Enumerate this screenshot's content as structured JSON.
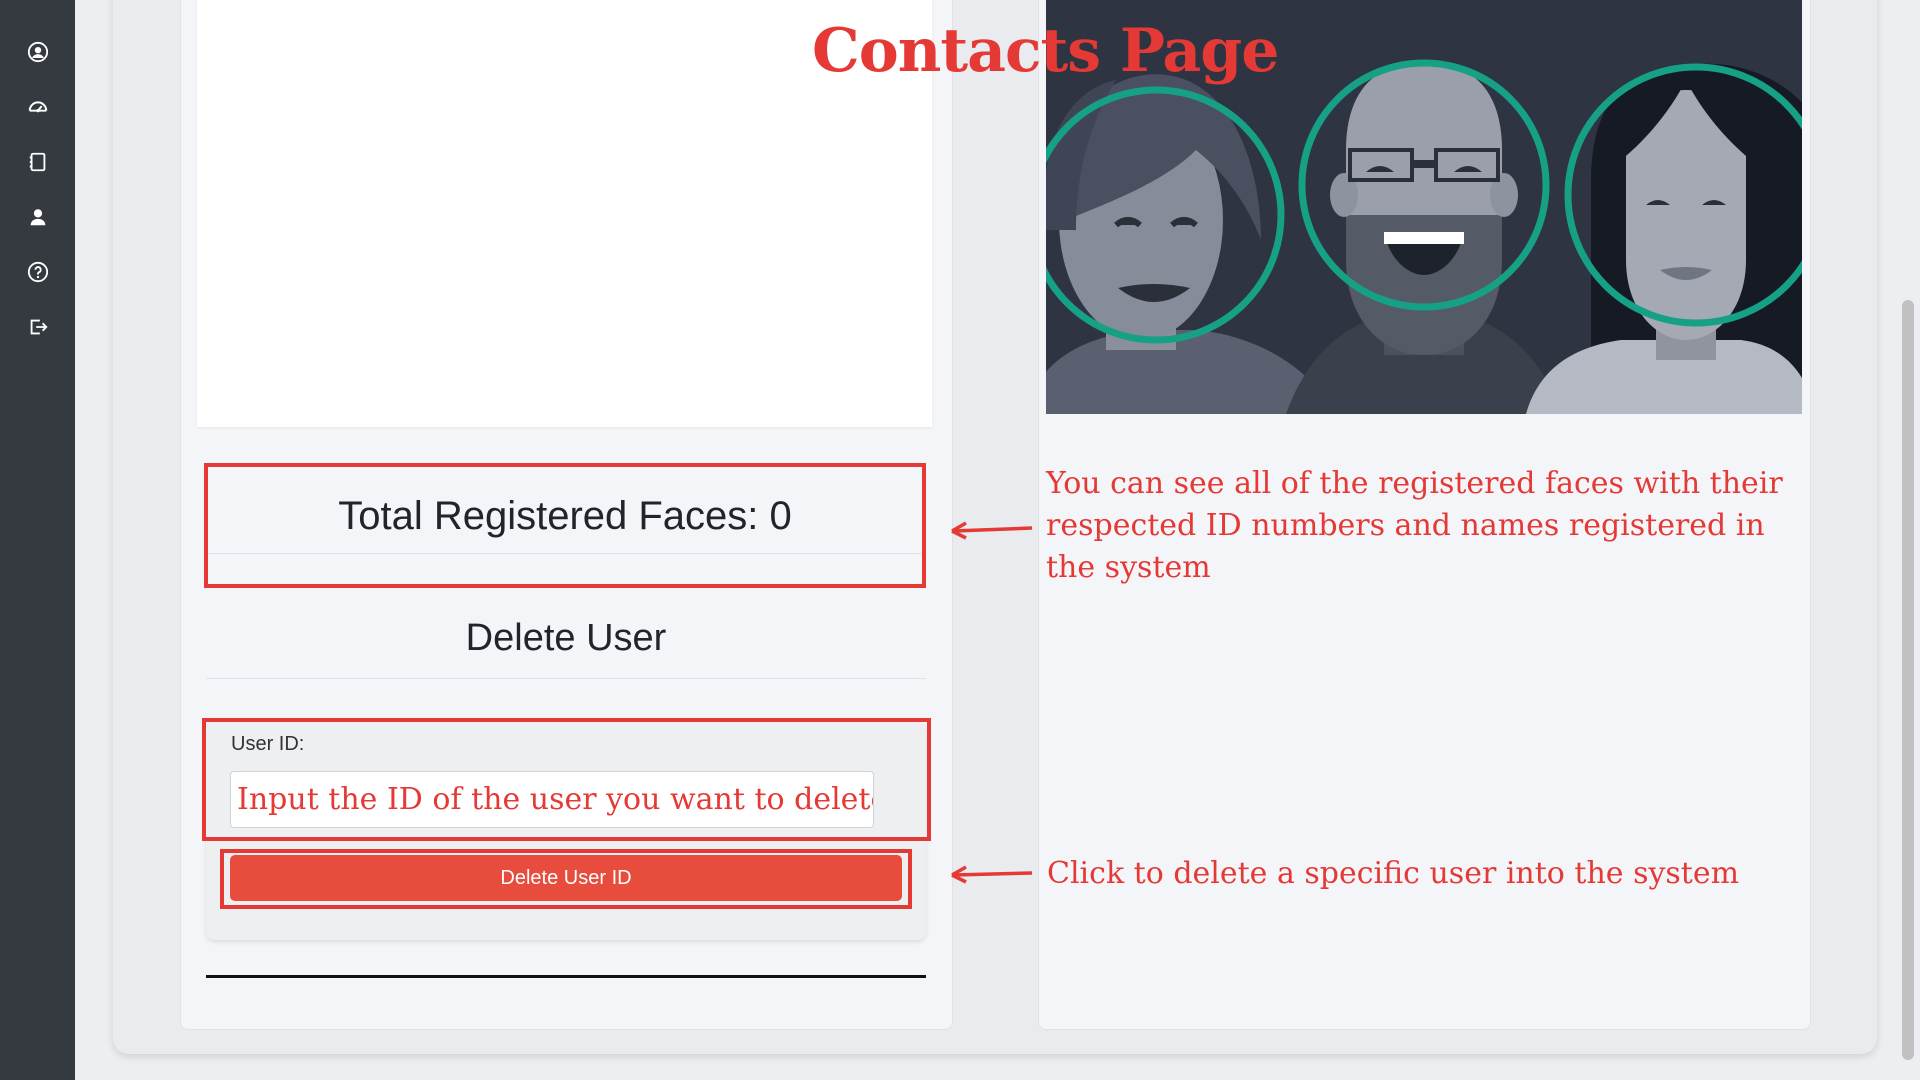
{
  "sidebar": {
    "icons": [
      "user-circle-icon",
      "dashboard-gauge-icon",
      "contacts-book-icon",
      "user-icon",
      "help-icon",
      "logout-icon"
    ]
  },
  "annotations": {
    "page_title": "Contacts Page",
    "faces_note": "You can see all of the registered faces with their respected ID numbers and names registered in the system",
    "delete_note": "Click to delete a specific user into the system"
  },
  "left_panel": {
    "total_faces_label": "Total Registered Faces: 0",
    "delete_section_title": "Delete User",
    "user_id_label": "User ID:",
    "user_id_placeholder": "Input the ID of the user you want to delete",
    "delete_button_label": "Delete User ID"
  },
  "colors": {
    "accent_red": "#e53935",
    "button_red": "#e74c3c",
    "sidebar_bg": "#343a40",
    "face_ring": "#16a085"
  }
}
